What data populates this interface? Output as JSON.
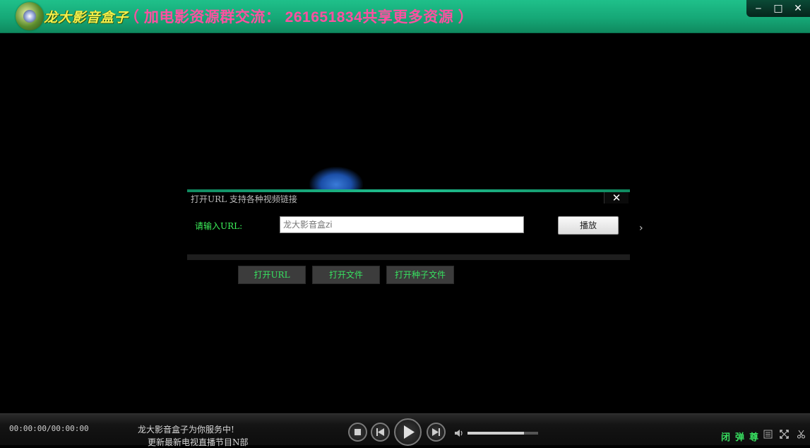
{
  "titlebar": {
    "brand": "龙大影音盒子",
    "promo": "（ 加电影资源群交流： 261651834共享更多资源 ）",
    "logo_icon": "dragon-logo-icon"
  },
  "window_controls": {
    "minimize": "‒",
    "maximize": "□",
    "close": "✕"
  },
  "dialog": {
    "title": "打开URL 支持各种视频链接",
    "close": "✕",
    "url_label": "请输入URL:",
    "url_placeholder": "龙大影音盒zi",
    "play_button": "播放",
    "arrow": "›",
    "buttons": [
      "打开URL",
      "打开文件",
      "打开种子文件"
    ]
  },
  "bottombar": {
    "time": "00:00:00/00:00:00",
    "status_line1": "龙大影音盒子为你服务中!",
    "status_line2": "更新最新电视直播节目N部",
    "volume_fraction": 0.8,
    "toggles": [
      "闭",
      "弹",
      "尊"
    ]
  },
  "colors": {
    "titlebar": "#16a877",
    "accent_green": "#38e060",
    "promo_pink": "#ff4fa0"
  }
}
